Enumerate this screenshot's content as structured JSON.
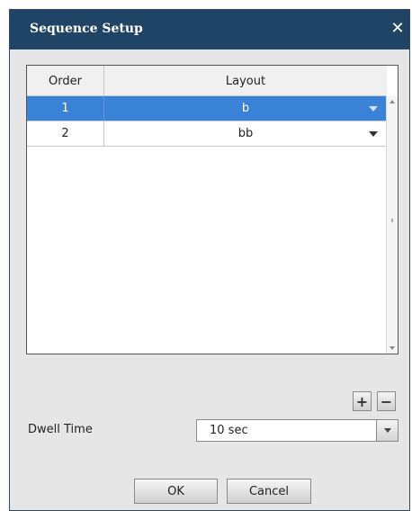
{
  "window": {
    "title": "Sequence Setup",
    "close_symbol": "✕"
  },
  "grid": {
    "columns": [
      "Order",
      "Layout"
    ],
    "rows": [
      {
        "order": "1",
        "layout": "b",
        "selected": true
      },
      {
        "order": "2",
        "layout": "bb",
        "selected": false
      }
    ]
  },
  "actions": {
    "add": "+",
    "remove": "−"
  },
  "dwell": {
    "label": "Dwell Time",
    "value": "10 sec"
  },
  "buttons": {
    "ok": "OK",
    "cancel": "Cancel"
  },
  "colors": {
    "title_bar": "#1f4466",
    "selection": "#3a82d6",
    "dialog_bg": "#e6e6e6"
  }
}
